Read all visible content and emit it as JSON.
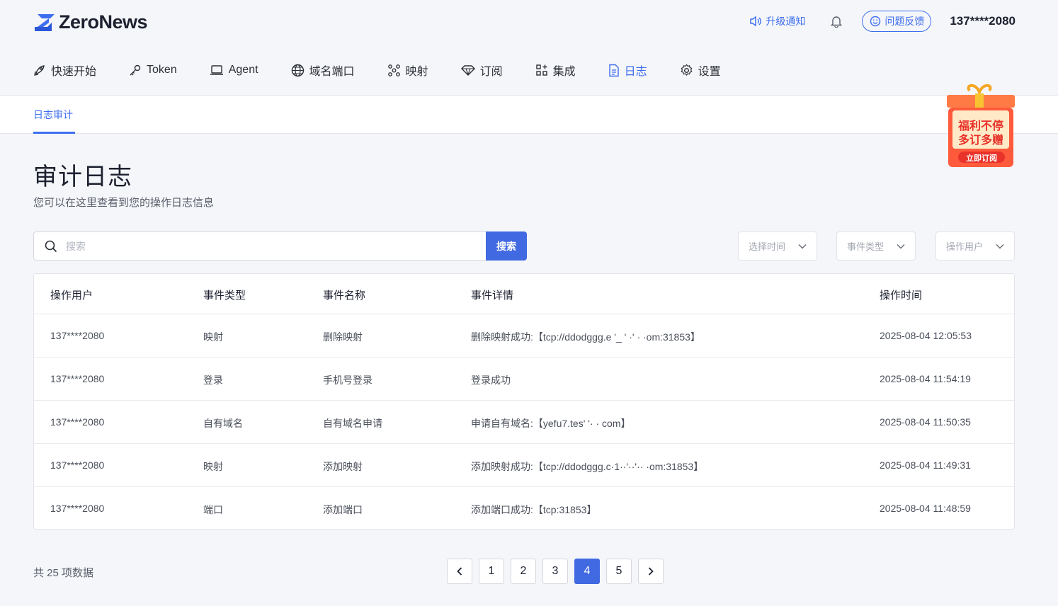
{
  "header": {
    "logo_text": "ZeroNews",
    "upgrade_label": "升级通知",
    "feedback_label": "问题反馈",
    "user": "137****2080"
  },
  "nav": {
    "items": [
      {
        "label": "快速开始",
        "icon": "rocket-icon"
      },
      {
        "label": "Token",
        "icon": "key-icon"
      },
      {
        "label": "Agent",
        "icon": "laptop-icon"
      },
      {
        "label": "域名端口",
        "icon": "globe-icon"
      },
      {
        "label": "映射",
        "icon": "mapping-icon"
      },
      {
        "label": "订阅",
        "icon": "diamond-icon"
      },
      {
        "label": "集成",
        "icon": "apps-icon"
      },
      {
        "label": "日志",
        "icon": "document-icon",
        "active": true
      },
      {
        "label": "设置",
        "icon": "gear-icon"
      }
    ]
  },
  "subnav": {
    "tab": "日志审计"
  },
  "promo": {
    "line1": "福利不停",
    "line2": "多订多赠",
    "button": "立即订阅"
  },
  "page": {
    "title": "审计日志",
    "subtitle": "您可以在这里查看到您的操作日志信息"
  },
  "search": {
    "placeholder": "搜索",
    "button": "搜索"
  },
  "filters": {
    "time": "选择时间",
    "event_type": "事件类型",
    "user": "操作用户"
  },
  "table": {
    "headers": [
      "操作用户",
      "事件类型",
      "事件名称",
      "事件详情",
      "操作时间"
    ],
    "rows": [
      [
        "137****2080",
        "映射",
        "删除映射",
        "删除映射成功:【tcp://ddodggg.e '_ '  ·' ·  ·om:31853】",
        "2025-08-04 12:05:53"
      ],
      [
        "137****2080",
        "登录",
        "手机号登录",
        "登录成功",
        "2025-08-04 11:54:19"
      ],
      [
        "137****2080",
        "自有域名",
        "自有域名申请",
        "申请自有域名:【yefu7.tes'        '·  ·    com】",
        "2025-08-04 11:50:35"
      ],
      [
        "137****2080",
        "映射",
        "添加映射",
        "添加映射成功:【tcp://ddodggg.c·1··'··'·· ·om:31853】",
        "2025-08-04 11:49:31"
      ],
      [
        "137****2080",
        "端口",
        "添加端口",
        "添加端口成功:【tcp:31853】",
        "2025-08-04 11:48:59"
      ]
    ]
  },
  "pagination": {
    "total": "共 25 项数据",
    "pages": [
      "1",
      "2",
      "3",
      "4",
      "5"
    ],
    "current": "4"
  },
  "colors": {
    "accent": "#3d6ef0",
    "button": "#4169e1",
    "background": "#f5f6f9"
  }
}
